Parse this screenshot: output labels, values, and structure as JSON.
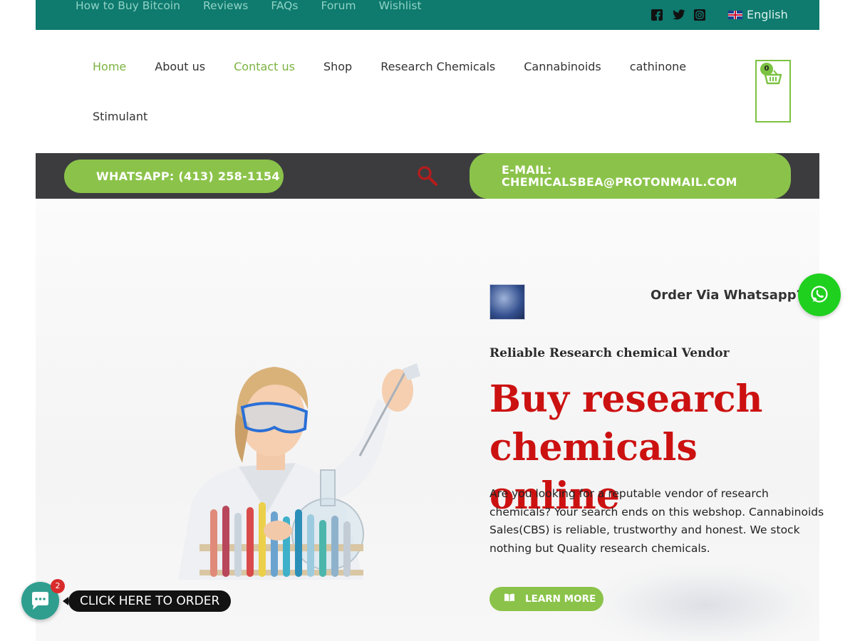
{
  "topbar": {
    "nav": [
      "How to Buy Bitcoin",
      "Reviews",
      "FAQs",
      "Forum",
      "Wishlist"
    ],
    "social_icons": [
      "facebook-icon",
      "twitter-icon",
      "instagram-icon"
    ],
    "language": "English"
  },
  "mainnav": {
    "items_row1": [
      "Home",
      "About us",
      "Contact us",
      "Shop",
      "Research Chemicals",
      "Cannabinoids",
      "cathinone"
    ],
    "items_row2": [
      "Stimulant"
    ],
    "active": "Home",
    "cart_count": "0"
  },
  "contact_band": {
    "whatsapp": "WHATSAPP: (413) 258-1154",
    "email_line1": "E-MAIL:",
    "email_line2": "CHEMICALSBEA@PROTONMAIL.COM"
  },
  "hero": {
    "order_whatsapp": "Order Via Whatsapp?",
    "tagline": "Reliable Research chemical Vendor",
    "headline_line1": "Buy research",
    "headline_line2": "chemicals online",
    "body": "Are you looking for a reputable vendor of research chemicals? Your search ends on this webshop. Cannabinoids Sales(CBS) is reliable, trustworthy and honest. We stock nothing but Quality research chemicals.",
    "learn_more": "LEARN MORE"
  },
  "floating": {
    "badge": "2",
    "label": "CLICK HERE TO ORDER"
  },
  "colors": {
    "topbar": "#0f7a6e",
    "accent_green": "#8bc34a",
    "headline_red": "#cc1111",
    "band_dark": "#3c3c3f",
    "whatsapp_green": "#1fd01f"
  }
}
